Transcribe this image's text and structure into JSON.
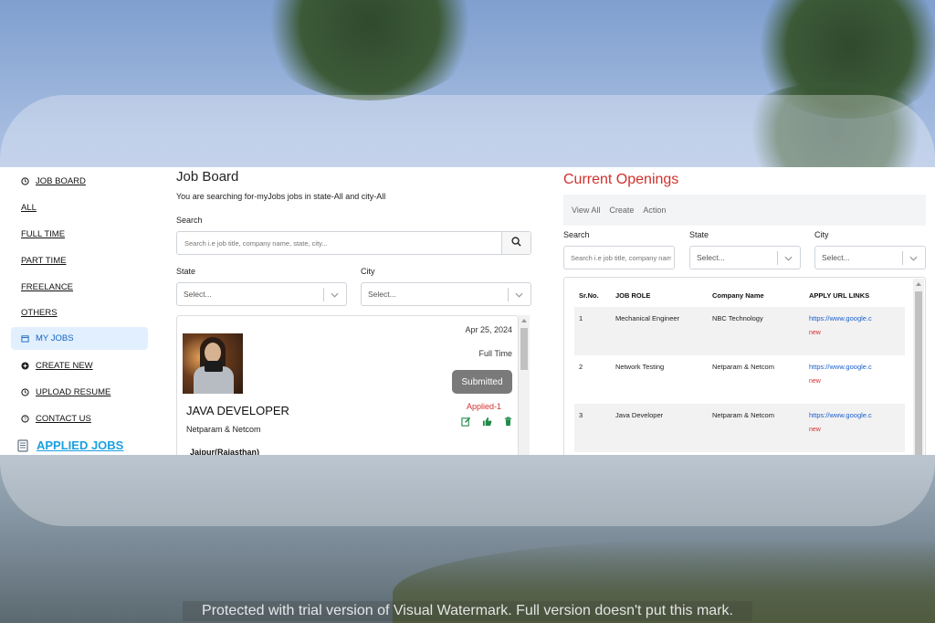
{
  "sidebar": {
    "items": [
      {
        "label": "JOB BOARD",
        "icon": "clock-icon"
      },
      {
        "label": "ALL"
      },
      {
        "label": "FULL TIME"
      },
      {
        "label": "PART TIME"
      },
      {
        "label": "FREELANCE"
      },
      {
        "label": "OTHERS"
      },
      {
        "label": "MY JOBS",
        "icon": "calendar-icon",
        "active": true
      },
      {
        "label": "CREATE NEW",
        "icon": "plus-circle-icon"
      },
      {
        "label": "UPLOAD RESUME",
        "icon": "clock-icon"
      },
      {
        "label": "CONTACT US",
        "icon": "question-icon"
      },
      {
        "label": "APPLIED JOBS",
        "icon": "document-icon"
      }
    ]
  },
  "job_board": {
    "title": "Job Board",
    "subtitle": "You are searching for-myJobs jobs in state-All and city-All",
    "search_label": "Search",
    "search_placeholder": "Search i.e job title, company name, state, city...",
    "state_label": "State",
    "state_value": "Select...",
    "city_label": "City",
    "city_value": "Select..."
  },
  "job_card": {
    "date": "Apr 25, 2024",
    "type": "Full Time",
    "status": "Submitted",
    "title": "JAVA DEVELOPER",
    "company": "Netparam & Netcom",
    "applied": "Applied-1",
    "location": "Jaipur(Rajasthan)"
  },
  "openings": {
    "title": "Current Openings",
    "tabs": [
      "View All",
      "Create",
      "Action"
    ],
    "search_label": "Search",
    "search_placeholder": "Search i.e job title, company name",
    "state_label": "State",
    "state_value": "Select...",
    "city_label": "City",
    "city_value": "Select...",
    "columns": [
      "Sr.No.",
      "JOB ROLE",
      "Company Name",
      "APPLY URL LINKS"
    ],
    "rows": [
      {
        "sr": "1",
        "role": "Mechanical Engineer",
        "company": "NBC Technology",
        "link": "https://www.google.c",
        "badge": "new"
      },
      {
        "sr": "2",
        "role": "Network Testing",
        "company": "Netparam & Netcom",
        "link": "https://www.google.c",
        "badge": "new"
      },
      {
        "sr": "3",
        "role": "Java Developer",
        "company": "Netparam & Netcom",
        "link": "https://www.google.c",
        "badge": "new"
      }
    ]
  },
  "watermark": "Protected with trial version of Visual Watermark. Full version doesn't put this mark.",
  "colors": {
    "accent_red": "#d0312d",
    "link_blue": "#1a5fd0",
    "active_bg": "#e1efff",
    "applied_cyan": "#1aa0e0"
  }
}
